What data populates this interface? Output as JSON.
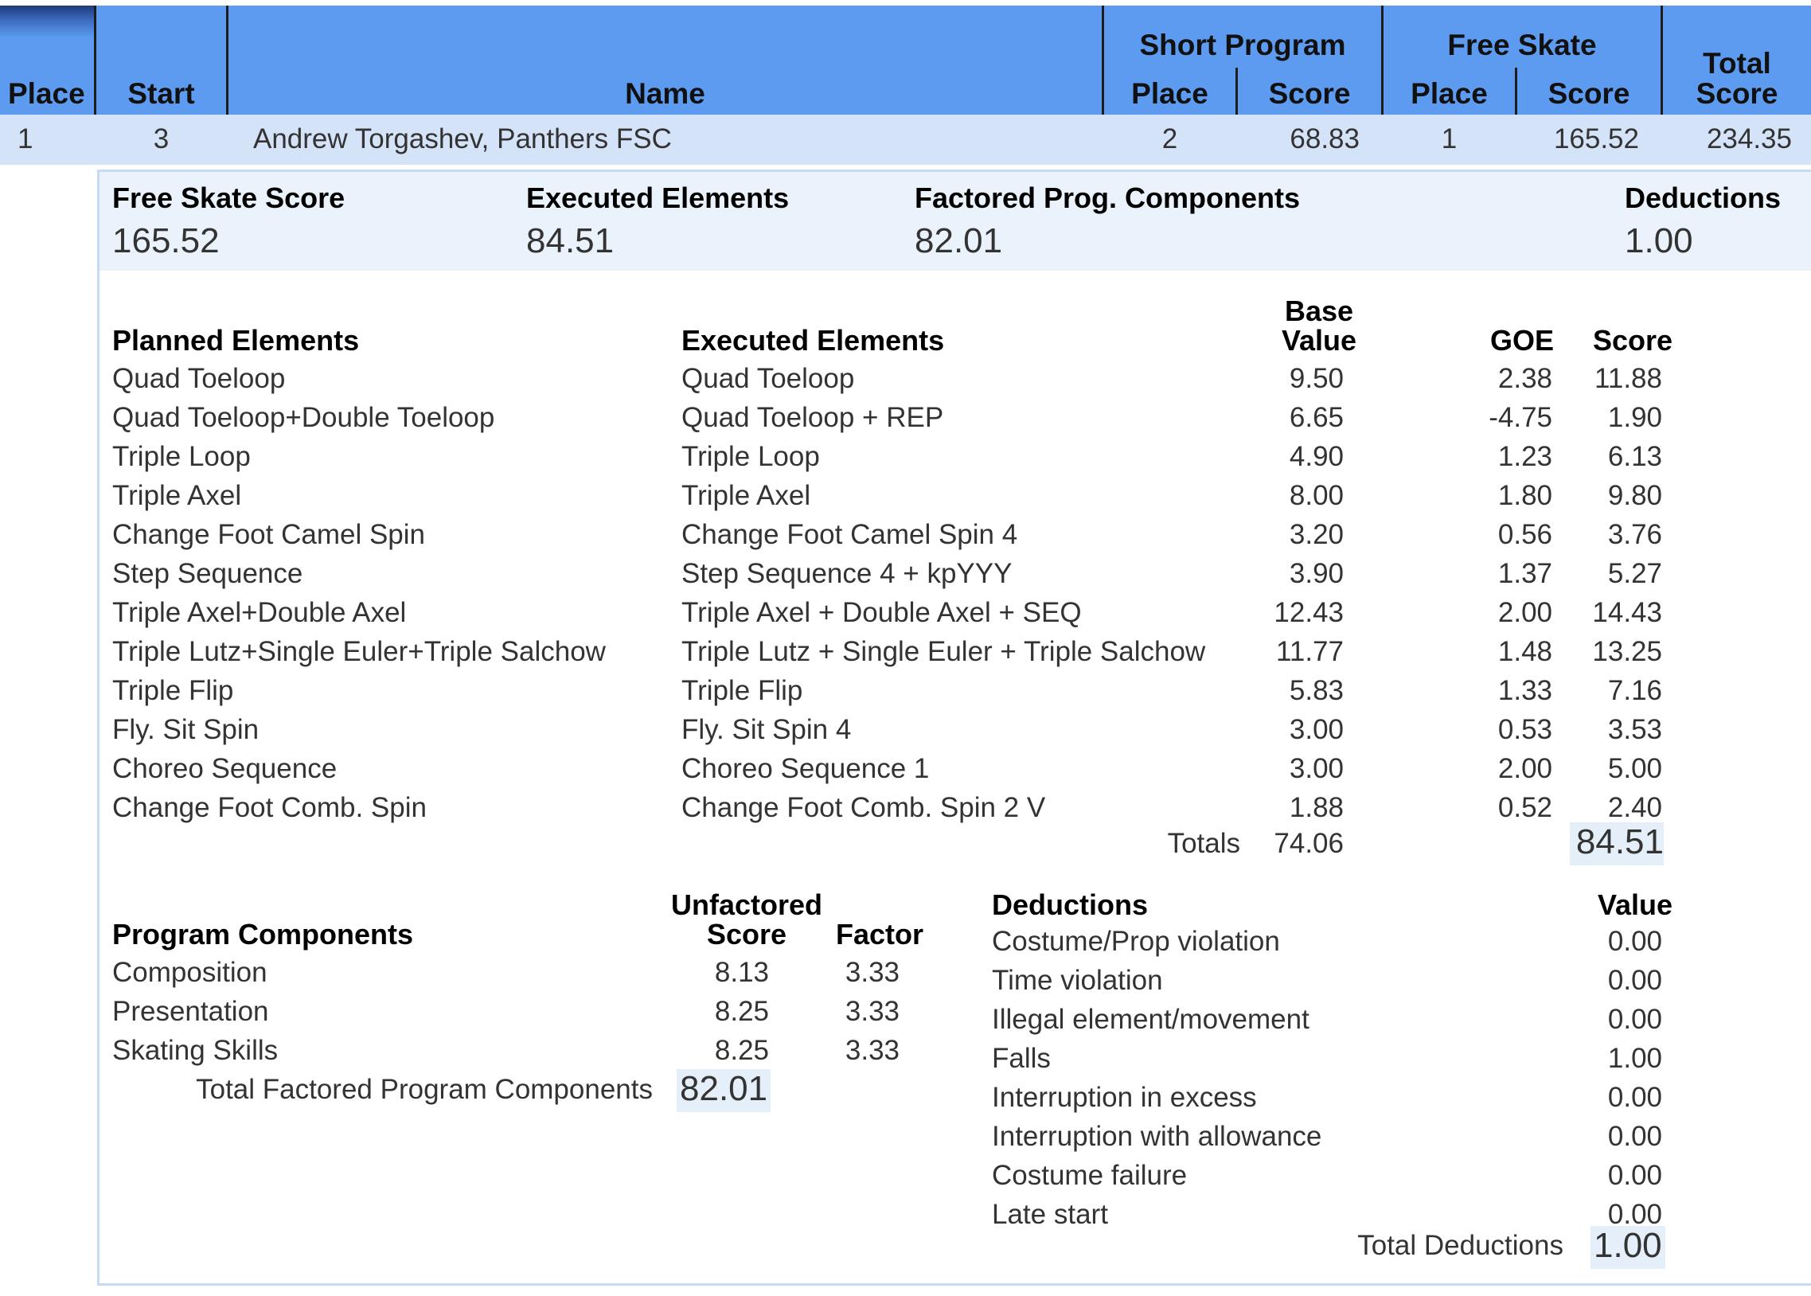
{
  "header": {
    "place": "Place",
    "start": "Start",
    "name": "Name",
    "short_program": "Short Program",
    "free_skate": "Free Skate",
    "sp_place": "Place",
    "sp_score": "Score",
    "fs_place": "Place",
    "fs_score": "Score",
    "total_line1": "Total",
    "total_line2": "Score"
  },
  "row": {
    "place": "1",
    "start": "3",
    "name": "Andrew Torgashev, Panthers FSC",
    "sp_place": "2",
    "sp_score": "68.83",
    "fs_place": "1",
    "fs_score": "165.52",
    "total": "234.35"
  },
  "summary": {
    "fs_score_label": "Free Skate Score",
    "fs_score_value": "165.52",
    "exec_label": "Executed Elements",
    "exec_value": "84.51",
    "pcs_label": "Factored Prog. Components",
    "pcs_value": "82.01",
    "ded_label": "Deductions",
    "ded_value": "1.00"
  },
  "elements": {
    "planned_header": "Planned Elements",
    "executed_header": "Executed Elements",
    "base_header_1": "Base",
    "base_header_2": "Value",
    "goe_header": "GOE",
    "score_header": "Score",
    "rows": [
      {
        "planned": "Quad Toeloop",
        "executed": "Quad Toeloop",
        "base": "9.50",
        "goe": "2.38",
        "score": "11.88"
      },
      {
        "planned": "Quad Toeloop+Double Toeloop",
        "executed": "Quad Toeloop + REP",
        "base": "6.65",
        "goe": "-4.75",
        "score": "1.90"
      },
      {
        "planned": "Triple Loop",
        "executed": "Triple Loop",
        "base": "4.90",
        "goe": "1.23",
        "score": "6.13"
      },
      {
        "planned": "Triple Axel",
        "executed": "Triple Axel",
        "base": "8.00",
        "goe": "1.80",
        "score": "9.80"
      },
      {
        "planned": "Change Foot Camel Spin",
        "executed": "Change Foot Camel Spin 4",
        "base": "3.20",
        "goe": "0.56",
        "score": "3.76"
      },
      {
        "planned": "Step Sequence",
        "executed": "Step Sequence 4 + kpYYY",
        "base": "3.90",
        "goe": "1.37",
        "score": "5.27"
      },
      {
        "planned": "Triple Axel+Double Axel",
        "executed": "Triple Axel + Double Axel + SEQ",
        "base": "12.43",
        "goe": "2.00",
        "score": "14.43"
      },
      {
        "planned": "Triple Lutz+Single Euler+Triple Salchow",
        "executed": "Triple Lutz + Single Euler + Triple Salchow",
        "base": "11.77",
        "goe": "1.48",
        "score": "13.25"
      },
      {
        "planned": "Triple Flip",
        "executed": "Triple Flip",
        "base": "5.83",
        "goe": "1.33",
        "score": "7.16"
      },
      {
        "planned": "Fly. Sit Spin",
        "executed": "Fly. Sit Spin 4",
        "base": "3.00",
        "goe": "0.53",
        "score": "3.53"
      },
      {
        "planned": "Choreo Sequence",
        "executed": "Choreo Sequence 1",
        "base": "3.00",
        "goe": "2.00",
        "score": "5.00"
      },
      {
        "planned": "Change Foot Comb. Spin",
        "executed": "Change Foot Comb. Spin 2 V",
        "base": "1.88",
        "goe": "0.52",
        "score": "2.40"
      }
    ],
    "totals_label": "Totals",
    "totals_base": "74.06",
    "totals_score": "84.51"
  },
  "components": {
    "header": "Program Components",
    "unfactored_1": "Unfactored",
    "unfactored_2": "Score",
    "factor_header": "Factor",
    "rows": [
      {
        "name": "Composition",
        "score": "8.13",
        "factor": "3.33"
      },
      {
        "name": "Presentation",
        "score": "8.25",
        "factor": "3.33"
      },
      {
        "name": "Skating Skills",
        "score": "8.25",
        "factor": "3.33"
      }
    ],
    "total_label": "Total Factored Program Components",
    "total_value": "82.01"
  },
  "deductions": {
    "header": "Deductions",
    "value_header": "Value",
    "rows": [
      {
        "name": "Costume/Prop violation",
        "value": "0.00"
      },
      {
        "name": "Time violation",
        "value": "0.00"
      },
      {
        "name": "Illegal element/movement",
        "value": "0.00"
      },
      {
        "name": "Falls",
        "value": "1.00"
      },
      {
        "name": "Interruption in excess",
        "value": "0.00"
      },
      {
        "name": "Interruption with allowance",
        "value": "0.00"
      },
      {
        "name": "Costume failure",
        "value": "0.00"
      },
      {
        "name": "Late start",
        "value": "0.00"
      }
    ],
    "total_label": "Total Deductions",
    "total_value": "1.00"
  },
  "colors": {
    "header_bg": "#5c9bef",
    "row_bg": "#d4e3f7",
    "panel_bg": "#eaf2fb",
    "border": "#c5daf3"
  }
}
